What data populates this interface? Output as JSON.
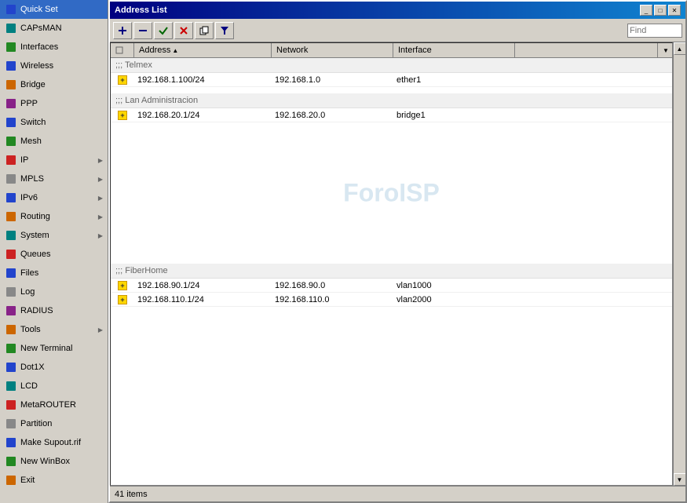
{
  "sidebar": {
    "items": [
      {
        "id": "quick-set",
        "label": "Quick Set",
        "icon": "q",
        "hasArrow": false
      },
      {
        "id": "capsman",
        "label": "CAPsMAN",
        "icon": "c",
        "hasArrow": false
      },
      {
        "id": "interfaces",
        "label": "Interfaces",
        "icon": "i",
        "hasArrow": false
      },
      {
        "id": "wireless",
        "label": "Wireless",
        "icon": "w",
        "hasArrow": false
      },
      {
        "id": "bridge",
        "label": "Bridge",
        "icon": "b",
        "hasArrow": false
      },
      {
        "id": "ppp",
        "label": "PPP",
        "icon": "p",
        "hasArrow": false
      },
      {
        "id": "switch",
        "label": "Switch",
        "icon": "s",
        "hasArrow": false
      },
      {
        "id": "mesh",
        "label": "Mesh",
        "icon": "m",
        "hasArrow": false
      },
      {
        "id": "ip",
        "label": "IP",
        "icon": "ip",
        "hasArrow": true
      },
      {
        "id": "mpls",
        "label": "MPLS",
        "icon": "ml",
        "hasArrow": true
      },
      {
        "id": "ipv6",
        "label": "IPv6",
        "icon": "6",
        "hasArrow": true
      },
      {
        "id": "routing",
        "label": "Routing",
        "icon": "r",
        "hasArrow": true
      },
      {
        "id": "system",
        "label": "System",
        "icon": "sy",
        "hasArrow": true
      },
      {
        "id": "queues",
        "label": "Queues",
        "icon": "qu",
        "hasArrow": false
      },
      {
        "id": "files",
        "label": "Files",
        "icon": "f",
        "hasArrow": false
      },
      {
        "id": "log",
        "label": "Log",
        "icon": "l",
        "hasArrow": false
      },
      {
        "id": "radius",
        "label": "RADIUS",
        "icon": "ra",
        "hasArrow": false
      },
      {
        "id": "tools",
        "label": "Tools",
        "icon": "t",
        "hasArrow": true
      },
      {
        "id": "new-terminal",
        "label": "New Terminal",
        "icon": "nt",
        "hasArrow": false
      },
      {
        "id": "dot1x",
        "label": "Dot1X",
        "icon": "d",
        "hasArrow": false
      },
      {
        "id": "lcd",
        "label": "LCD",
        "icon": "lc",
        "hasArrow": false
      },
      {
        "id": "metarouter",
        "label": "MetaROUTER",
        "icon": "mr",
        "hasArrow": false
      },
      {
        "id": "partition",
        "label": "Partition",
        "icon": "pa",
        "hasArrow": false
      },
      {
        "id": "make-supout",
        "label": "Make Supout.rif",
        "icon": "ms",
        "hasArrow": false
      },
      {
        "id": "new-winbox",
        "label": "New WinBox",
        "icon": "nw",
        "hasArrow": false
      },
      {
        "id": "exit",
        "label": "Exit",
        "icon": "ex",
        "hasArrow": false
      }
    ]
  },
  "window": {
    "title": "Address List",
    "controls": {
      "minimize": "_",
      "maximize": "□",
      "close": "✕"
    }
  },
  "toolbar": {
    "add": "+",
    "remove": "−",
    "check": "✓",
    "cross": "✕",
    "copy": "⧉",
    "filter": "⊟",
    "find_placeholder": "Find"
  },
  "table": {
    "columns": [
      "",
      "Address",
      "Network",
      "Interface",
      ""
    ],
    "groups": [
      {
        "name": ";;; Telmex",
        "rows": [
          {
            "address": "192.168.1.100/24",
            "network": "192.168.1.0",
            "interface": "ether1"
          }
        ]
      },
      {
        "name": ";;; Lan Administracion",
        "rows": [
          {
            "address": "192.168.20.1/24",
            "network": "192.168.20.0",
            "interface": "bridge1"
          }
        ]
      },
      {
        "name": ";;; FiberHome",
        "rows": [
          {
            "address": "192.168.90.1/24",
            "network": "192.168.90.0",
            "interface": "vlan1000"
          },
          {
            "address": "192.168.110.1/24",
            "network": "192.168.110.0",
            "interface": "vlan2000"
          }
        ]
      }
    ],
    "watermark": "ForoISP",
    "status": "41 items"
  }
}
